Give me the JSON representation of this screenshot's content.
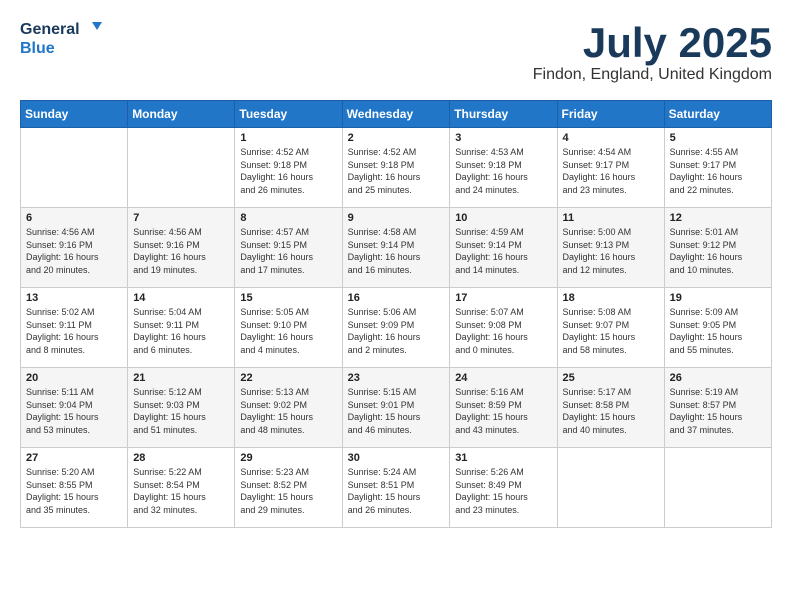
{
  "header": {
    "logo_line1": "General",
    "logo_line2": "Blue",
    "month": "July 2025",
    "location": "Findon, England, United Kingdom"
  },
  "days_of_week": [
    "Sunday",
    "Monday",
    "Tuesday",
    "Wednesday",
    "Thursday",
    "Friday",
    "Saturday"
  ],
  "weeks": [
    [
      {
        "day": "",
        "content": ""
      },
      {
        "day": "",
        "content": ""
      },
      {
        "day": "1",
        "content": "Sunrise: 4:52 AM\nSunset: 9:18 PM\nDaylight: 16 hours\nand 26 minutes."
      },
      {
        "day": "2",
        "content": "Sunrise: 4:52 AM\nSunset: 9:18 PM\nDaylight: 16 hours\nand 25 minutes."
      },
      {
        "day": "3",
        "content": "Sunrise: 4:53 AM\nSunset: 9:18 PM\nDaylight: 16 hours\nand 24 minutes."
      },
      {
        "day": "4",
        "content": "Sunrise: 4:54 AM\nSunset: 9:17 PM\nDaylight: 16 hours\nand 23 minutes."
      },
      {
        "day": "5",
        "content": "Sunrise: 4:55 AM\nSunset: 9:17 PM\nDaylight: 16 hours\nand 22 minutes."
      }
    ],
    [
      {
        "day": "6",
        "content": "Sunrise: 4:56 AM\nSunset: 9:16 PM\nDaylight: 16 hours\nand 20 minutes."
      },
      {
        "day": "7",
        "content": "Sunrise: 4:56 AM\nSunset: 9:16 PM\nDaylight: 16 hours\nand 19 minutes."
      },
      {
        "day": "8",
        "content": "Sunrise: 4:57 AM\nSunset: 9:15 PM\nDaylight: 16 hours\nand 17 minutes."
      },
      {
        "day": "9",
        "content": "Sunrise: 4:58 AM\nSunset: 9:14 PM\nDaylight: 16 hours\nand 16 minutes."
      },
      {
        "day": "10",
        "content": "Sunrise: 4:59 AM\nSunset: 9:14 PM\nDaylight: 16 hours\nand 14 minutes."
      },
      {
        "day": "11",
        "content": "Sunrise: 5:00 AM\nSunset: 9:13 PM\nDaylight: 16 hours\nand 12 minutes."
      },
      {
        "day": "12",
        "content": "Sunrise: 5:01 AM\nSunset: 9:12 PM\nDaylight: 16 hours\nand 10 minutes."
      }
    ],
    [
      {
        "day": "13",
        "content": "Sunrise: 5:02 AM\nSunset: 9:11 PM\nDaylight: 16 hours\nand 8 minutes."
      },
      {
        "day": "14",
        "content": "Sunrise: 5:04 AM\nSunset: 9:11 PM\nDaylight: 16 hours\nand 6 minutes."
      },
      {
        "day": "15",
        "content": "Sunrise: 5:05 AM\nSunset: 9:10 PM\nDaylight: 16 hours\nand 4 minutes."
      },
      {
        "day": "16",
        "content": "Sunrise: 5:06 AM\nSunset: 9:09 PM\nDaylight: 16 hours\nand 2 minutes."
      },
      {
        "day": "17",
        "content": "Sunrise: 5:07 AM\nSunset: 9:08 PM\nDaylight: 16 hours\nand 0 minutes."
      },
      {
        "day": "18",
        "content": "Sunrise: 5:08 AM\nSunset: 9:07 PM\nDaylight: 15 hours\nand 58 minutes."
      },
      {
        "day": "19",
        "content": "Sunrise: 5:09 AM\nSunset: 9:05 PM\nDaylight: 15 hours\nand 55 minutes."
      }
    ],
    [
      {
        "day": "20",
        "content": "Sunrise: 5:11 AM\nSunset: 9:04 PM\nDaylight: 15 hours\nand 53 minutes."
      },
      {
        "day": "21",
        "content": "Sunrise: 5:12 AM\nSunset: 9:03 PM\nDaylight: 15 hours\nand 51 minutes."
      },
      {
        "day": "22",
        "content": "Sunrise: 5:13 AM\nSunset: 9:02 PM\nDaylight: 15 hours\nand 48 minutes."
      },
      {
        "day": "23",
        "content": "Sunrise: 5:15 AM\nSunset: 9:01 PM\nDaylight: 15 hours\nand 46 minutes."
      },
      {
        "day": "24",
        "content": "Sunrise: 5:16 AM\nSunset: 8:59 PM\nDaylight: 15 hours\nand 43 minutes."
      },
      {
        "day": "25",
        "content": "Sunrise: 5:17 AM\nSunset: 8:58 PM\nDaylight: 15 hours\nand 40 minutes."
      },
      {
        "day": "26",
        "content": "Sunrise: 5:19 AM\nSunset: 8:57 PM\nDaylight: 15 hours\nand 37 minutes."
      }
    ],
    [
      {
        "day": "27",
        "content": "Sunrise: 5:20 AM\nSunset: 8:55 PM\nDaylight: 15 hours\nand 35 minutes."
      },
      {
        "day": "28",
        "content": "Sunrise: 5:22 AM\nSunset: 8:54 PM\nDaylight: 15 hours\nand 32 minutes."
      },
      {
        "day": "29",
        "content": "Sunrise: 5:23 AM\nSunset: 8:52 PM\nDaylight: 15 hours\nand 29 minutes."
      },
      {
        "day": "30",
        "content": "Sunrise: 5:24 AM\nSunset: 8:51 PM\nDaylight: 15 hours\nand 26 minutes."
      },
      {
        "day": "31",
        "content": "Sunrise: 5:26 AM\nSunset: 8:49 PM\nDaylight: 15 hours\nand 23 minutes."
      },
      {
        "day": "",
        "content": ""
      },
      {
        "day": "",
        "content": ""
      }
    ]
  ]
}
